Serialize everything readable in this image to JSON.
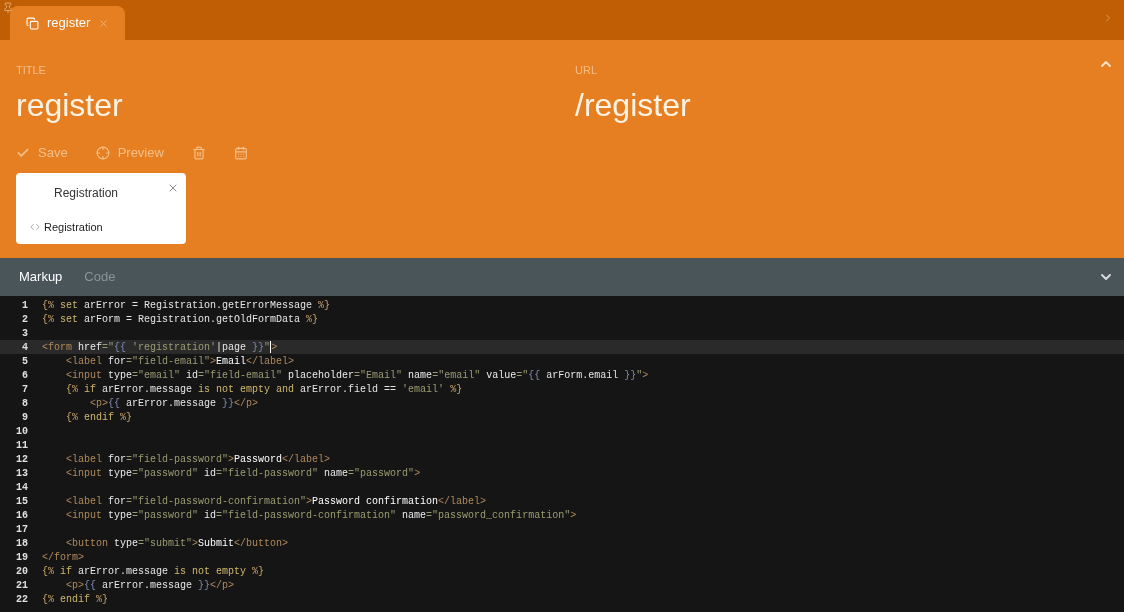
{
  "tabs": [
    {
      "label": "register",
      "selected": true
    }
  ],
  "header": {
    "title_label": "TITLE",
    "title_value": "register",
    "url_label": "URL",
    "url_value": "/register"
  },
  "toolbar": [
    {
      "kind": "save",
      "label": "Save"
    },
    {
      "kind": "preview",
      "label": "Preview"
    },
    {
      "kind": "delete"
    },
    {
      "kind": "calendar"
    }
  ],
  "component_card": {
    "title": "Registration",
    "alias": "Registration"
  },
  "editor_tabs": [
    {
      "label": "Markup",
      "selected": true
    },
    {
      "label": "Code",
      "selected": false
    }
  ],
  "code_lines": [
    {
      "number": "1",
      "active": false,
      "tokens": [
        {
          "kind": "delim",
          "text": "{%"
        },
        {
          "kind": "keyword",
          "text": " set "
        },
        {
          "kind": "ident",
          "text": "arError = Registration.getErrorMessage "
        },
        {
          "kind": "delim",
          "text": "%}"
        }
      ]
    },
    {
      "number": "2",
      "active": false,
      "tokens": [
        {
          "kind": "delim",
          "text": "{%"
        },
        {
          "kind": "keyword",
          "text": " set "
        },
        {
          "kind": "ident",
          "text": "arForm = Registration.getOldFormData "
        },
        {
          "kind": "delim",
          "text": "%}"
        }
      ]
    },
    {
      "number": "3",
      "active": false
    },
    {
      "number": "4",
      "active": true,
      "tokens": [
        {
          "kind": "tag",
          "text": "<form"
        },
        {
          "kind": "attr",
          "text": " href"
        },
        {
          "kind": "str",
          "text": "=\""
        },
        {
          "kind": "interp",
          "text": "{{"
        },
        {
          "kind": "str",
          "text": " 'registration'"
        },
        {
          "kind": "ident",
          "text": "|page "
        },
        {
          "kind": "interp",
          "text": "}}"
        },
        {
          "kind": "str",
          "text": "\""
        },
        {
          "kind": "cursor"
        },
        {
          "kind": "tag",
          "text": ">"
        }
      ]
    },
    {
      "number": "5",
      "active": false,
      "tokens": [
        {
          "kind": "tag",
          "text": "    <label"
        },
        {
          "kind": "attr",
          "text": " for"
        },
        {
          "kind": "str",
          "text": "=\"field-email\""
        },
        {
          "kind": "tag",
          "text": ">"
        },
        {
          "kind": "text",
          "text": "Email"
        },
        {
          "kind": "tag",
          "text": "</label>"
        }
      ]
    },
    {
      "number": "6",
      "active": false,
      "tokens": [
        {
          "kind": "tag",
          "text": "    <input"
        },
        {
          "kind": "attr",
          "text": " type"
        },
        {
          "kind": "str",
          "text": "=\"email\""
        },
        {
          "kind": "attr",
          "text": " id"
        },
        {
          "kind": "str",
          "text": "=\"field-email\""
        },
        {
          "kind": "attr",
          "text": " placeholder"
        },
        {
          "kind": "str",
          "text": "=\"Email\""
        },
        {
          "kind": "attr",
          "text": " name"
        },
        {
          "kind": "str",
          "text": "=\"email\""
        },
        {
          "kind": "attr",
          "text": " value"
        },
        {
          "kind": "str",
          "text": "=\""
        },
        {
          "kind": "interp",
          "text": "{{"
        },
        {
          "kind": "ident",
          "text": " arForm.email "
        },
        {
          "kind": "interp",
          "text": "}}"
        },
        {
          "kind": "str",
          "text": "\""
        },
        {
          "kind": "tag",
          "text": ">"
        }
      ]
    },
    {
      "number": "7",
      "active": false,
      "tokens": [
        {
          "kind": "delim",
          "text": "    {%"
        },
        {
          "kind": "keyword",
          "text": " if "
        },
        {
          "kind": "ident",
          "text": "arError.message "
        },
        {
          "kind": "keyword",
          "text": "is not empty and "
        },
        {
          "kind": "ident",
          "text": "arError.field == "
        },
        {
          "kind": "str",
          "text": "'email' "
        },
        {
          "kind": "delim",
          "text": "%}"
        }
      ]
    },
    {
      "number": "8",
      "active": false,
      "tokens": [
        {
          "kind": "tag",
          "text": "        <p>"
        },
        {
          "kind": "interp",
          "text": "{{"
        },
        {
          "kind": "ident",
          "text": " arError.message "
        },
        {
          "kind": "interp",
          "text": "}}"
        },
        {
          "kind": "tag",
          "text": "</p>"
        }
      ]
    },
    {
      "number": "9",
      "active": false,
      "tokens": [
        {
          "kind": "delim",
          "text": "    {%"
        },
        {
          "kind": "keyword",
          "text": " endif "
        },
        {
          "kind": "delim",
          "text": "%}"
        }
      ]
    },
    {
      "number": "10",
      "active": false
    },
    {
      "number": "11",
      "active": false
    },
    {
      "number": "12",
      "active": false,
      "tokens": [
        {
          "kind": "tag",
          "text": "    <label"
        },
        {
          "kind": "attr",
          "text": " for"
        },
        {
          "kind": "str",
          "text": "=\"field-password\""
        },
        {
          "kind": "tag",
          "text": ">"
        },
        {
          "kind": "text",
          "text": "Password"
        },
        {
          "kind": "tag",
          "text": "</label>"
        }
      ]
    },
    {
      "number": "13",
      "active": false,
      "tokens": [
        {
          "kind": "tag",
          "text": "    <input"
        },
        {
          "kind": "attr",
          "text": " type"
        },
        {
          "kind": "str",
          "text": "=\"password\""
        },
        {
          "kind": "attr",
          "text": " id"
        },
        {
          "kind": "str",
          "text": "=\"field-password\""
        },
        {
          "kind": "attr",
          "text": " name"
        },
        {
          "kind": "str",
          "text": "=\"password\""
        },
        {
          "kind": "tag",
          "text": ">"
        }
      ]
    },
    {
      "number": "14",
      "active": false
    },
    {
      "number": "15",
      "active": false,
      "tokens": [
        {
          "kind": "tag",
          "text": "    <label"
        },
        {
          "kind": "attr",
          "text": " for"
        },
        {
          "kind": "str",
          "text": "=\"field-password-confirmation\""
        },
        {
          "kind": "tag",
          "text": ">"
        },
        {
          "kind": "text",
          "text": "Password confirmation"
        },
        {
          "kind": "tag",
          "text": "</label>"
        }
      ]
    },
    {
      "number": "16",
      "active": false,
      "tokens": [
        {
          "kind": "tag",
          "text": "    <input"
        },
        {
          "kind": "attr",
          "text": " type"
        },
        {
          "kind": "str",
          "text": "=\"password\""
        },
        {
          "kind": "attr",
          "text": " id"
        },
        {
          "kind": "str",
          "text": "=\"field-password-confirmation\""
        },
        {
          "kind": "attr",
          "text": " name"
        },
        {
          "kind": "str",
          "text": "=\"password_confirmation\""
        },
        {
          "kind": "tag",
          "text": ">"
        }
      ]
    },
    {
      "number": "17",
      "active": false
    },
    {
      "number": "18",
      "active": false,
      "tokens": [
        {
          "kind": "tag",
          "text": "    <button"
        },
        {
          "kind": "attr",
          "text": " type"
        },
        {
          "kind": "str",
          "text": "=\"submit\""
        },
        {
          "kind": "tag",
          "text": ">"
        },
        {
          "kind": "text",
          "text": "Submit"
        },
        {
          "kind": "tag",
          "text": "</button>"
        }
      ]
    },
    {
      "number": "19",
      "active": false,
      "tokens": [
        {
          "kind": "tag",
          "text": "</form>"
        }
      ]
    },
    {
      "number": "20",
      "active": false,
      "tokens": [
        {
          "kind": "delim",
          "text": "{%"
        },
        {
          "kind": "keyword",
          "text": " if "
        },
        {
          "kind": "ident",
          "text": "arError.message "
        },
        {
          "kind": "keyword",
          "text": "is not empty "
        },
        {
          "kind": "delim",
          "text": "%}"
        }
      ]
    },
    {
      "number": "21",
      "active": false,
      "tokens": [
        {
          "kind": "tag",
          "text": "    <p>"
        },
        {
          "kind": "interp",
          "text": "{{"
        },
        {
          "kind": "ident",
          "text": " arError.message "
        },
        {
          "kind": "interp",
          "text": "}}"
        },
        {
          "kind": "tag",
          "text": "</p>"
        }
      ]
    },
    {
      "number": "22",
      "active": false,
      "tokens": [
        {
          "kind": "delim",
          "text": "{%"
        },
        {
          "kind": "keyword",
          "text": " endif "
        },
        {
          "kind": "delim",
          "text": "%}"
        }
      ]
    }
  ]
}
